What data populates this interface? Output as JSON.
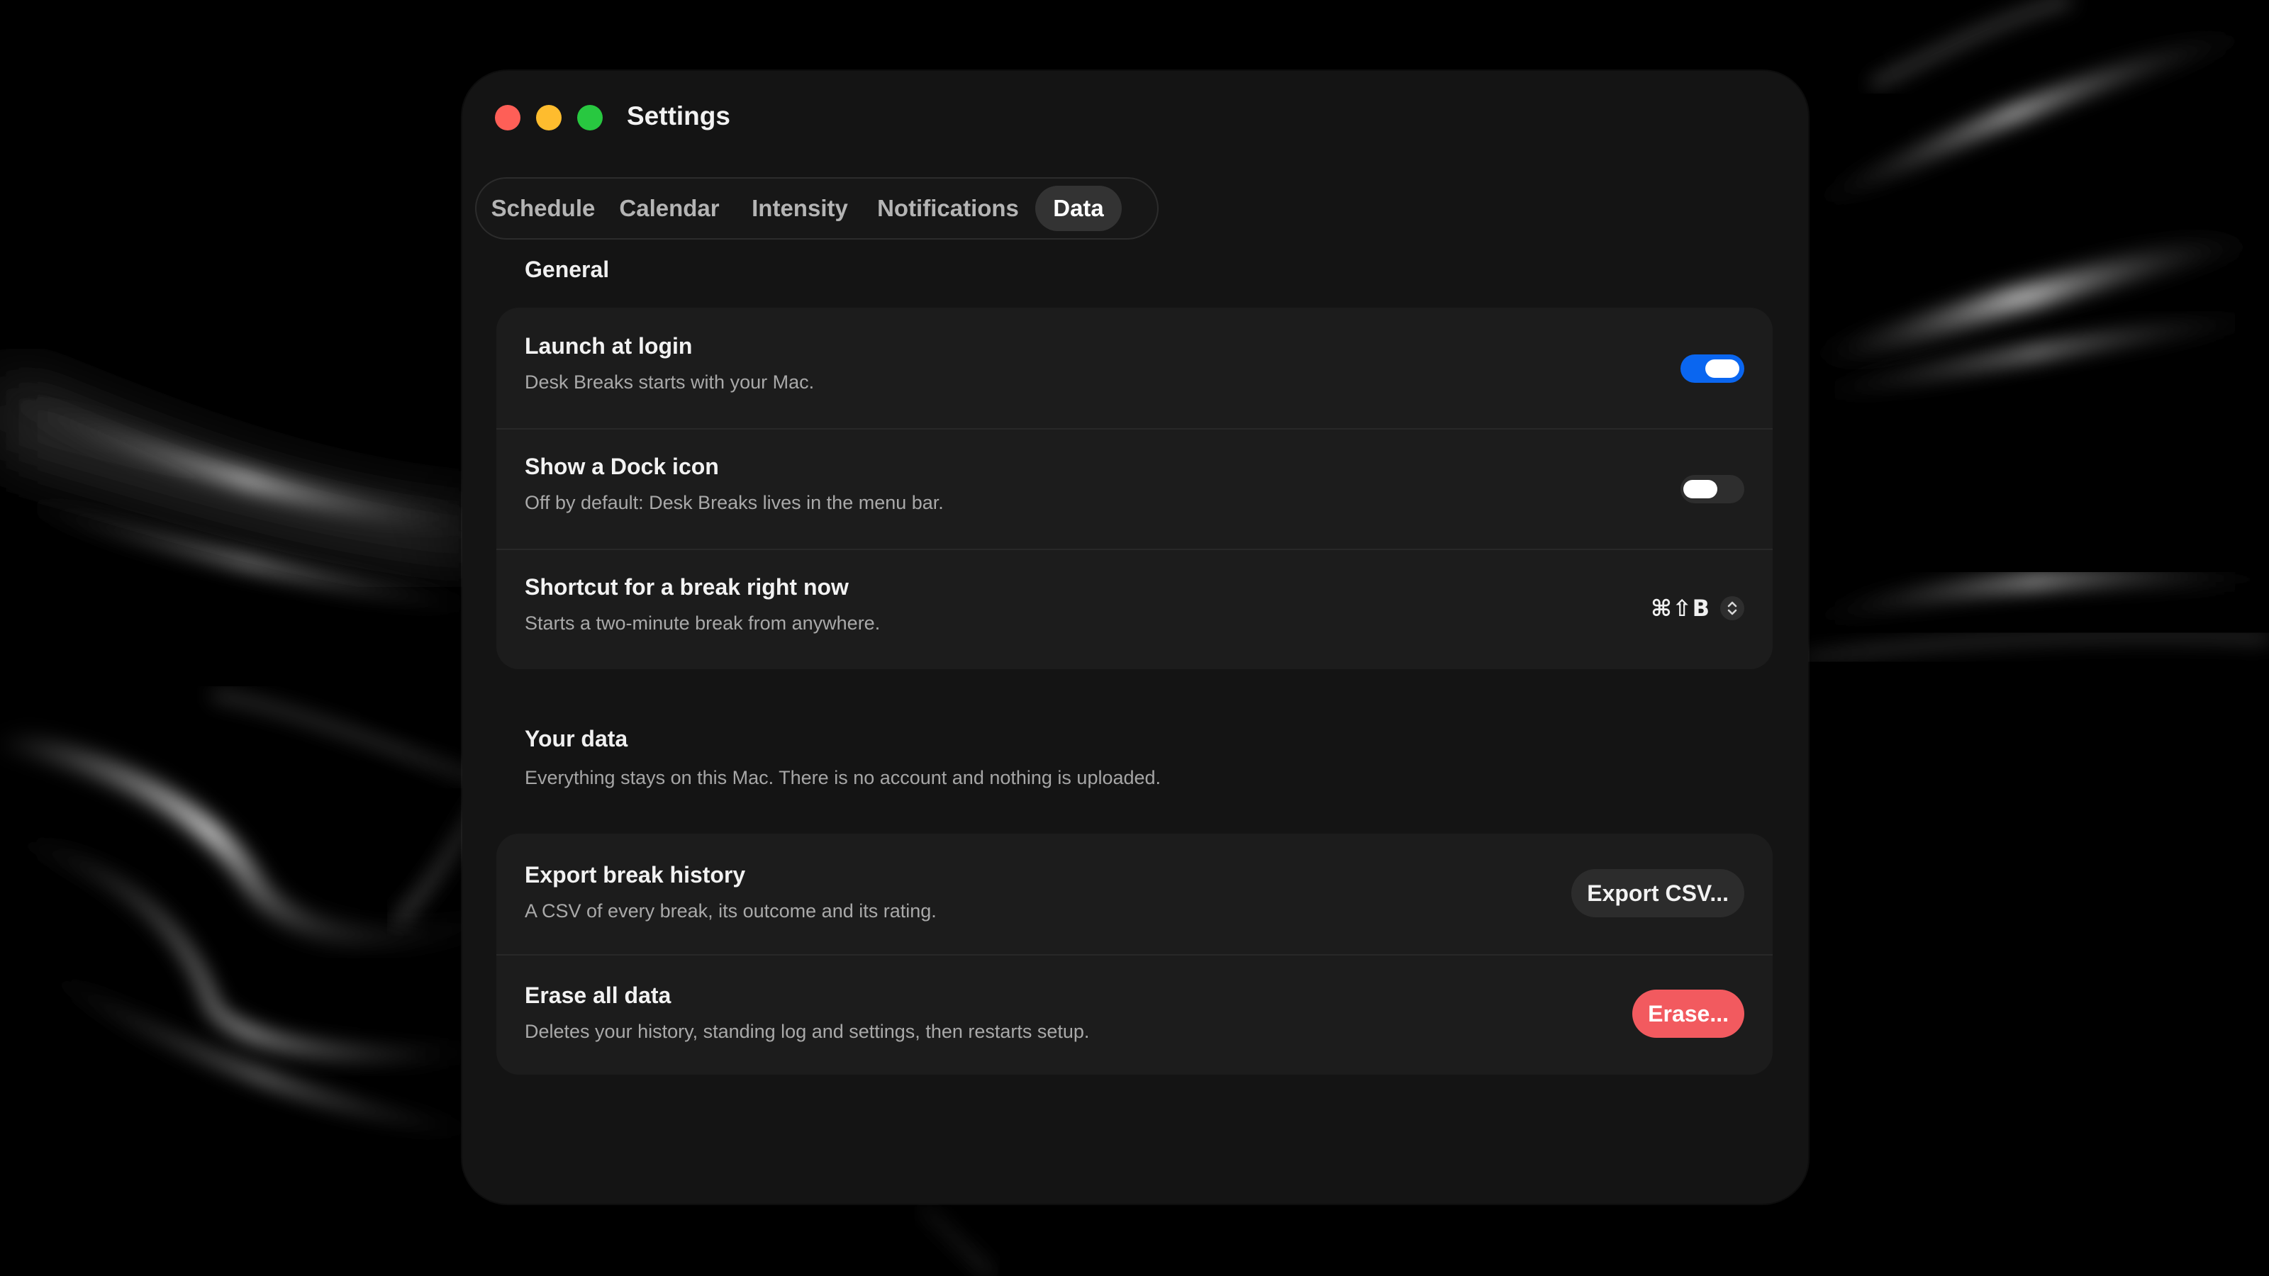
{
  "window": {
    "title": "Settings",
    "traffic_lights": [
      {
        "name": "close",
        "color": "#fe5f57"
      },
      {
        "name": "minimize",
        "color": "#febc2e"
      },
      {
        "name": "zoom",
        "color": "#28c840"
      }
    ]
  },
  "tabs": [
    {
      "label": "Schedule",
      "active": false
    },
    {
      "label": "Calendar",
      "active": false
    },
    {
      "label": "Intensity",
      "active": false
    },
    {
      "label": "Notifications",
      "active": false
    },
    {
      "label": "Data",
      "active": true
    }
  ],
  "general": {
    "title": "General",
    "rows": [
      {
        "title": "Launch at login",
        "description": "Desk Breaks starts with your Mac.",
        "control": "toggle",
        "on": true
      },
      {
        "title": "Show a Dock icon",
        "description": "Off by default: Desk Breaks lives in the menu bar.",
        "control": "toggle",
        "on": false
      },
      {
        "title": "Shortcut for a break right now",
        "description": "Starts a two-minute break from anywhere.",
        "control": "shortcut",
        "shortcut": "⌘⇧B"
      }
    ]
  },
  "your_data": {
    "title": "Your data",
    "description": "Everything stays on this Mac. There is no account and nothing is uploaded.",
    "rows": [
      {
        "title": "Export break history",
        "description": "A CSV of every break, its outcome and its rating.",
        "button": "Export CSV..."
      },
      {
        "title": "Erase all data",
        "description": "Deletes your history, standing log and settings, then restarts setup.",
        "button": "Erase..."
      }
    ]
  },
  "colors": {
    "toggle_on": "#0a66f0",
    "danger": "#f25a5f",
    "window_bg": "#141414",
    "card_bg": "#1c1c1c"
  },
  "icons": {
    "stepper": "chevron-up-down-icon"
  }
}
